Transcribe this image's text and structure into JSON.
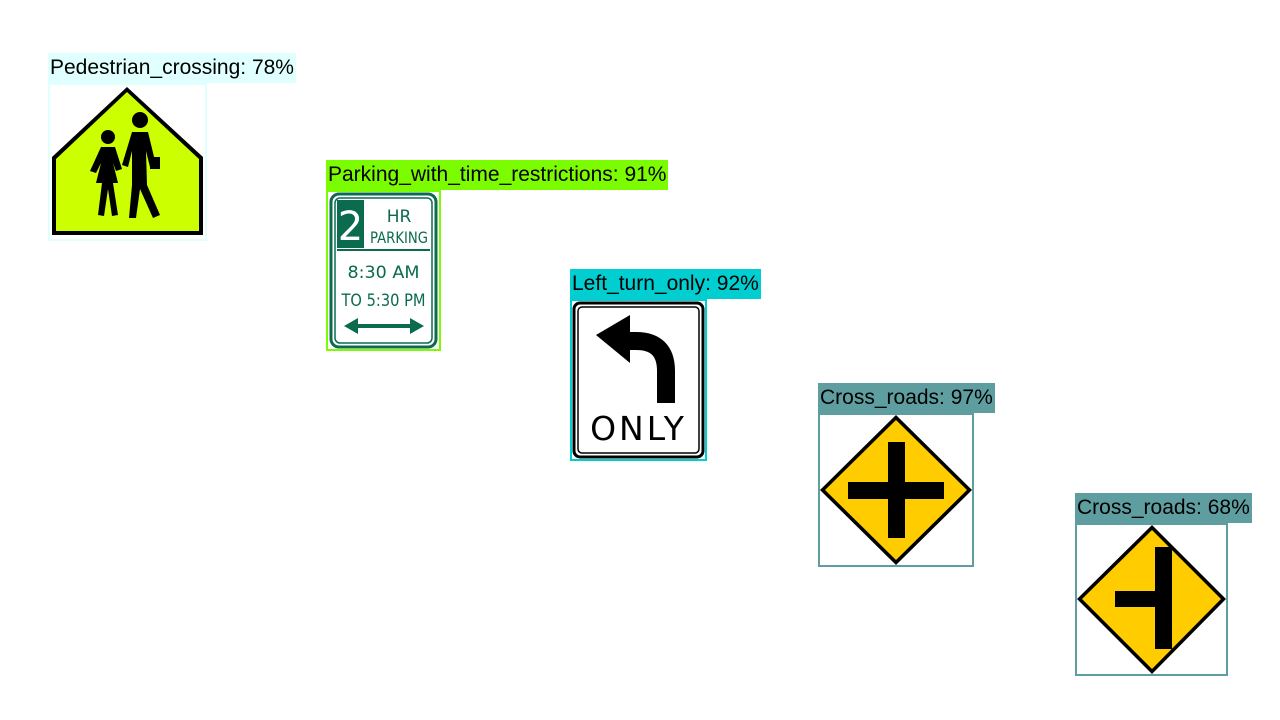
{
  "detections": [
    {
      "label": "Pedestrian_crossing: 78%",
      "class": "Pedestrian_crossing",
      "confidence": 0.78,
      "color": "#e0ffff",
      "sign": "school-crossing-sign"
    },
    {
      "label": "Parking_with_time_restrictions: 91%",
      "class": "Parking_with_time_restrictions",
      "confidence": 0.91,
      "color": "#7cfc00",
      "sign": "parking-time-sign",
      "sign_text": {
        "number": "2",
        "line1": "HR",
        "line2": "PARKING",
        "line3": "8:30 AM",
        "line4": "TO 5:30 PM"
      }
    },
    {
      "label": "Left_turn_only: 92%",
      "class": "Left_turn_only",
      "confidence": 0.92,
      "color": "#00ced1",
      "sign": "left-turn-only-sign",
      "sign_text": {
        "word": "ONLY"
      }
    },
    {
      "label": "Cross_roads: 97%",
      "class": "Cross_roads",
      "confidence": 0.97,
      "color": "#5f9ea0",
      "sign": "crossroads-sign"
    },
    {
      "label": "Cross_roads: 68%",
      "class": "Cross_roads",
      "confidence": 0.68,
      "color": "#5f9ea0",
      "sign": "side-road-sign"
    }
  ]
}
